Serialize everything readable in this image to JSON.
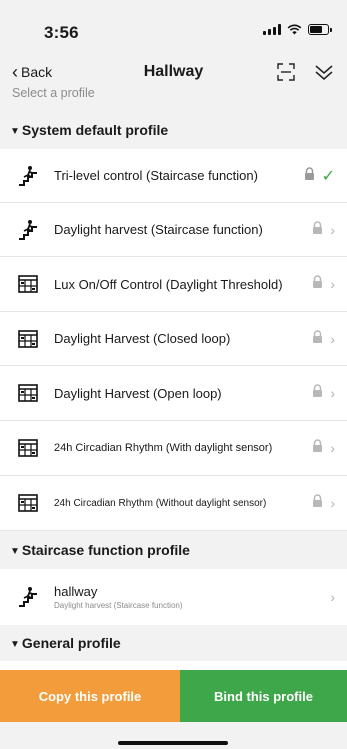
{
  "status_bar": {
    "time": "3:56"
  },
  "nav": {
    "back_label": "Back",
    "title": "Hallway",
    "scan_icon": "scan-frame-icon",
    "collapse_icon": "double-chevron-down-icon"
  },
  "hint": "Select a profile",
  "sections": {
    "system": {
      "title": "System default profile",
      "items": [
        {
          "label": "Tri-level control (Staircase function)",
          "icon": "staircase-person-icon",
          "selected": true
        },
        {
          "label": "Daylight harvest (Staircase function)",
          "icon": "staircase-person-icon"
        },
        {
          "label": "Lux On/Off Control (Daylight Threshold)",
          "icon": "sensor-grid-icon"
        },
        {
          "label": "Daylight Harvest (Closed loop)",
          "icon": "sensor-grid-icon"
        },
        {
          "label": "Daylight Harvest (Open loop)",
          "icon": "sensor-grid-icon"
        },
        {
          "label": "24h Circadian Rhythm (With daylight sensor)",
          "icon": "sensor-grid-icon"
        },
        {
          "label": "24h Circadian Rhythm (Without daylight sensor)",
          "icon": "sensor-grid-icon"
        }
      ]
    },
    "staircase": {
      "title": "Staircase function profile",
      "items": [
        {
          "label": "hallway",
          "sub": "Daylight harvest (Staircase function)",
          "icon": "staircase-person-icon"
        }
      ]
    },
    "general": {
      "title": "General profile"
    }
  },
  "actions": {
    "copy_label": "Copy this profile",
    "bind_label": "Bind this profile"
  },
  "colors": {
    "copy": "#f39c3c",
    "bind": "#3ea74a",
    "check": "#3ca64a"
  }
}
